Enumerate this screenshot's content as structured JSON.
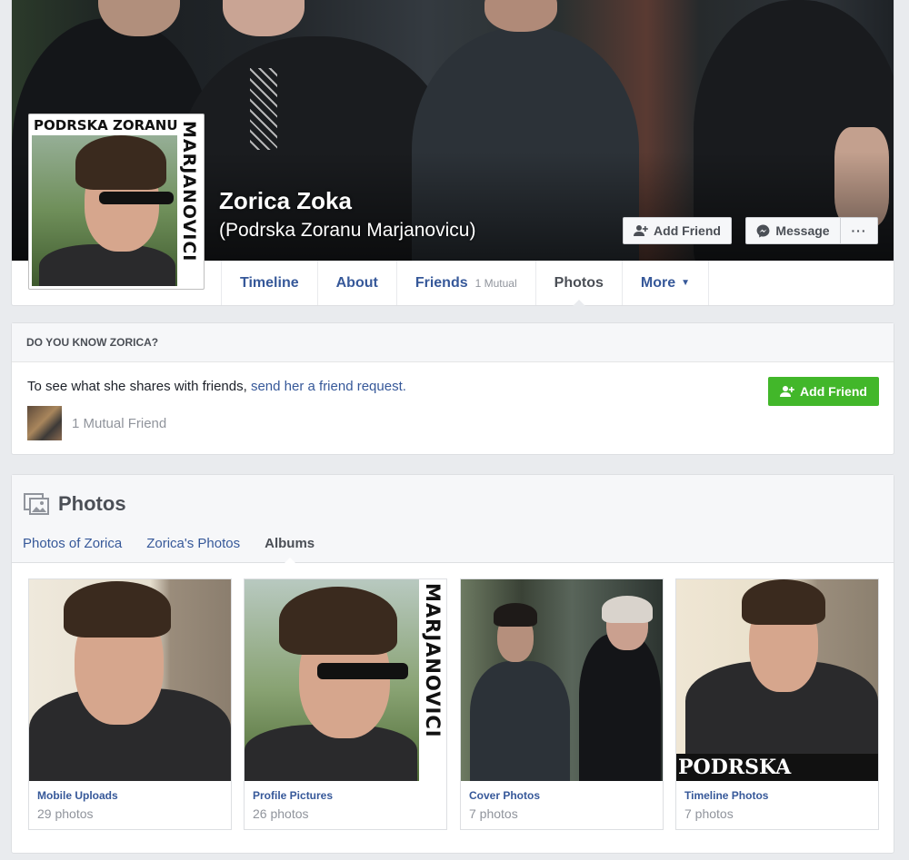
{
  "profile": {
    "name": "Zorica Zoka",
    "alternate_name": "(Podrska Zoranu Marjanovicu)",
    "profile_pic_top_text": "PODRSKA ZORANU",
    "profile_pic_side_text": "MARJANOVICI"
  },
  "header_actions": {
    "add_friend_label": "Add Friend",
    "message_label": "Message",
    "more_label": "···"
  },
  "tabs": [
    {
      "label": "Timeline"
    },
    {
      "label": "About"
    },
    {
      "label": "Friends",
      "count": "1 Mutual"
    },
    {
      "label": "Photos"
    },
    {
      "label": "More"
    }
  ],
  "know_card": {
    "heading": "DO YOU KNOW ZORICA?",
    "text": "To see what she shares with friends, ",
    "link_text": "send her a friend request.",
    "mutual_text": "1 Mutual Friend",
    "add_friend_label": "Add Friend"
  },
  "photos": {
    "title": "Photos",
    "subtabs": [
      {
        "label": "Photos of Zorica"
      },
      {
        "label": "Zorica's Photos"
      },
      {
        "label": "Albums"
      }
    ],
    "albums": [
      {
        "name": "Mobile Uploads",
        "count": "29 photos"
      },
      {
        "name": "Profile Pictures",
        "count": "26 photos",
        "side_text": "MARJANOVICI"
      },
      {
        "name": "Cover Photos",
        "count": "7 photos"
      },
      {
        "name": "Timeline Photos",
        "count": "7 photos",
        "banner_text": "PODRSKA"
      }
    ]
  },
  "colors": {
    "link": "#365899",
    "green_button": "#42b72a",
    "page_bg": "#e9ebee"
  },
  "icons": [
    "add-friend-icon",
    "messenger-icon",
    "more-dots-icon",
    "caret-down-icon",
    "photos-icon"
  ]
}
